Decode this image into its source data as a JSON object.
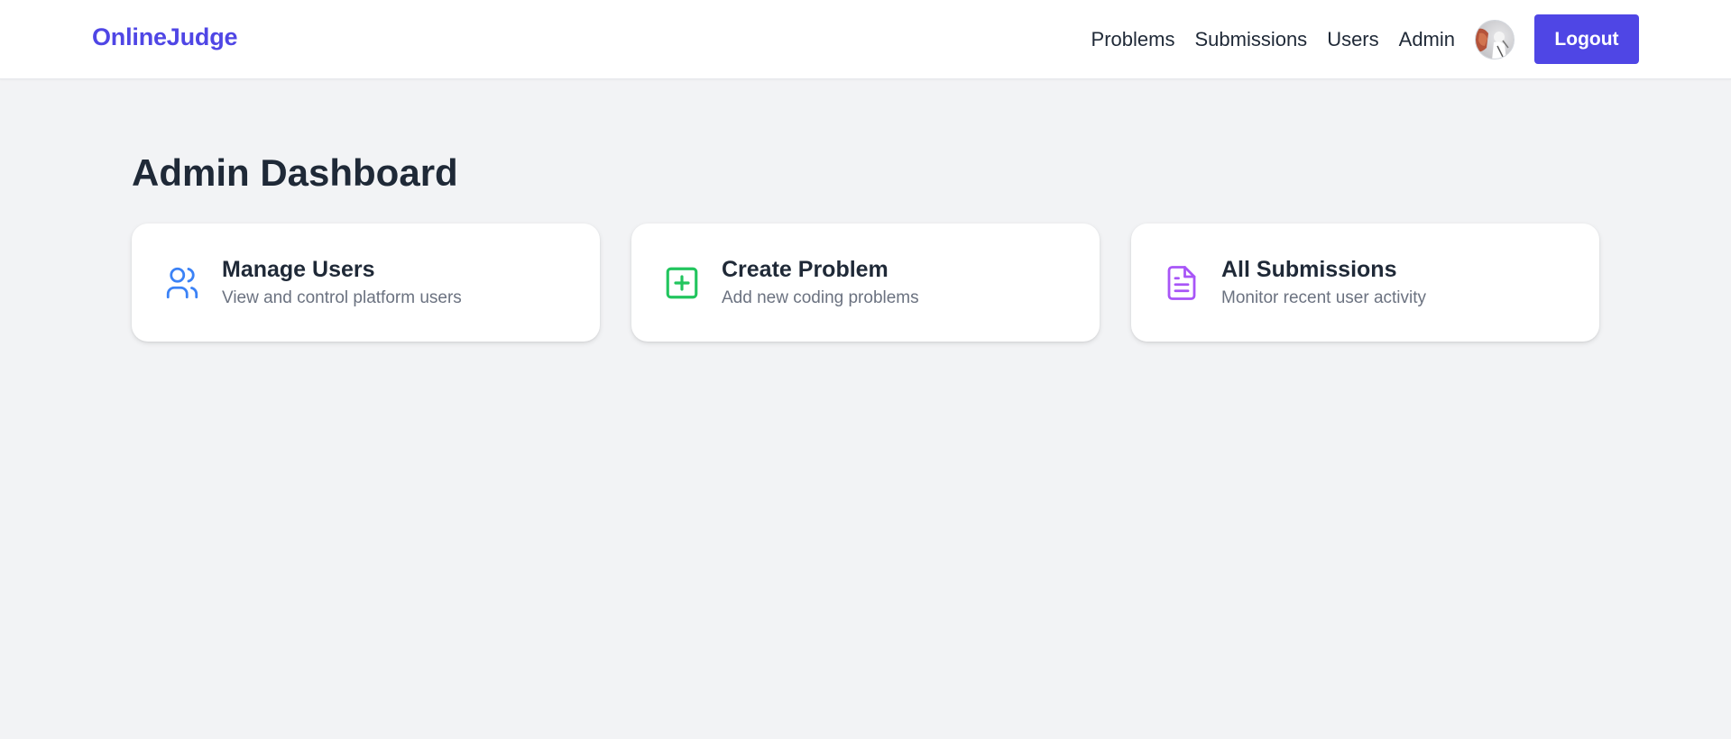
{
  "brand": "OnlineJudge",
  "nav": {
    "links": [
      "Problems",
      "Submissions",
      "Users",
      "Admin"
    ],
    "logout_label": "Logout"
  },
  "page": {
    "title": "Admin Dashboard"
  },
  "cards": [
    {
      "title": "Manage Users",
      "subtitle": "View and control platform users",
      "icon": "users-icon",
      "color": "#3b82f6"
    },
    {
      "title": "Create Problem",
      "subtitle": "Add new coding problems",
      "icon": "plus-square-icon",
      "color": "#22c55e"
    },
    {
      "title": "All Submissions",
      "subtitle": "Monitor recent user activity",
      "icon": "file-text-icon",
      "color": "#a855f7"
    }
  ],
  "colors": {
    "brand": "#4f46e5",
    "background": "#f2f3f5"
  }
}
